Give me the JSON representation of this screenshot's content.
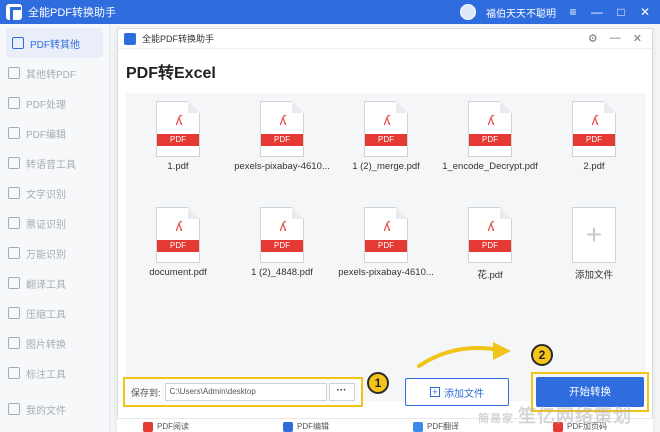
{
  "app": {
    "title": "全能PDF转换助手",
    "user": "福伯天天不聪明",
    "window_controls": [
      "≡",
      "—",
      "□",
      "✕"
    ],
    "accent": "#2f6ddf"
  },
  "sidebar": {
    "items": [
      {
        "label": "PDF转其他",
        "icon": "pdf-convert-icon"
      },
      {
        "label": "其他转PDF",
        "icon": "to-pdf-icon"
      },
      {
        "label": "PDF处理",
        "icon": "pdf-process-icon"
      },
      {
        "label": "PDF编辑",
        "icon": "pdf-edit-icon"
      },
      {
        "label": "转语音工具",
        "icon": "voice-icon"
      },
      {
        "label": "文字识别",
        "icon": "ocr-icon"
      },
      {
        "label": "票证识别",
        "icon": "ticket-icon"
      },
      {
        "label": "万能识别",
        "icon": "universal-icon"
      },
      {
        "label": "翻译工具",
        "icon": "translate-icon"
      },
      {
        "label": "压缩工具",
        "icon": "compress-icon"
      },
      {
        "label": "图片转换",
        "icon": "image-convert-icon"
      },
      {
        "label": "标注工具",
        "icon": "annotate-icon"
      }
    ],
    "bottom_item": {
      "label": "我的文件",
      "icon": "my-files-icon"
    }
  },
  "dialog": {
    "title": "全能PDF转换助手",
    "controls": [
      "⚙",
      "—",
      "✕"
    ],
    "heading": "PDF转Excel"
  },
  "files": [
    {
      "name": "1.pdf",
      "badge": "PDF"
    },
    {
      "name": "pexels-pixabay-4610...",
      "badge": "PDF"
    },
    {
      "name": "1 (2)_merge.pdf",
      "badge": "PDF"
    },
    {
      "name": "1_encode_Decrypt.pdf",
      "badge": "PDF"
    },
    {
      "name": "2.pdf",
      "badge": "PDF"
    },
    {
      "name": "document.pdf",
      "badge": "PDF"
    },
    {
      "name": "1 (2)_4848.pdf",
      "badge": "PDF"
    },
    {
      "name": "pexels-pixabay-4610...",
      "badge": "PDF"
    },
    {
      "name": "花.pdf",
      "badge": "PDF"
    }
  ],
  "add_tile": {
    "label": "添加文件",
    "symbol": "+"
  },
  "save": {
    "label": "保存到:",
    "path": "C:\\Users\\Admin\\desktop",
    "browse": "···"
  },
  "badges": {
    "one": "1",
    "two": "2"
  },
  "buttons": {
    "add_file": "添加文件",
    "start": "开始转换"
  },
  "bottom_strip": [
    "PDF阅读",
    "PDF编辑",
    "PDF翻译",
    "PDF加页码"
  ],
  "watermark": {
    "small": "简易家",
    "big": "笙亿网络策划"
  }
}
